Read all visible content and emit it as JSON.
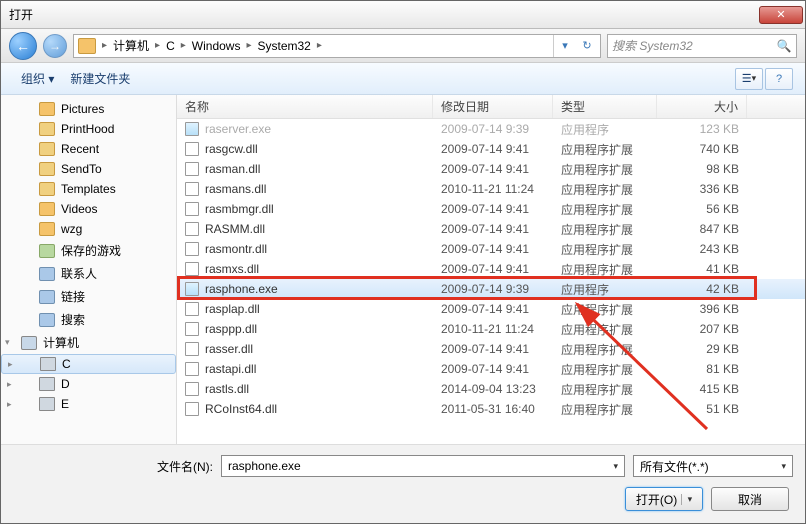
{
  "window": {
    "title": "打开"
  },
  "nav": {
    "segments": [
      "计算机",
      "C",
      "Windows",
      "System32"
    ],
    "search_placeholder": "搜索 System32"
  },
  "toolbar": {
    "organize": "组织 ▾",
    "newfolder": "新建文件夹"
  },
  "sidebar": [
    {
      "label": "Pictures",
      "icon": "folder",
      "lvl": 1
    },
    {
      "label": "PrintHood",
      "icon": "folder-alt",
      "lvl": 1
    },
    {
      "label": "Recent",
      "icon": "folder-alt",
      "lvl": 1
    },
    {
      "label": "SendTo",
      "icon": "folder-alt",
      "lvl": 1
    },
    {
      "label": "Templates",
      "icon": "folder-alt",
      "lvl": 1
    },
    {
      "label": "Videos",
      "icon": "folder",
      "lvl": 1
    },
    {
      "label": "wzg",
      "icon": "folder",
      "lvl": 1
    },
    {
      "label": "保存的游戏",
      "icon": "folder-green",
      "lvl": 1
    },
    {
      "label": "联系人",
      "icon": "folder-blue",
      "lvl": 1
    },
    {
      "label": "链接",
      "icon": "folder-blue",
      "lvl": 1
    },
    {
      "label": "搜索",
      "icon": "folder-blue",
      "lvl": 1
    },
    {
      "label": "计算机",
      "icon": "computer",
      "lvl": 0,
      "expand": "▾"
    },
    {
      "label": "C",
      "icon": "drive",
      "lvl": 1,
      "expand": "▸",
      "selected": true
    },
    {
      "label": "D",
      "icon": "drive",
      "lvl": 1,
      "expand": "▸"
    },
    {
      "label": "E",
      "icon": "drive",
      "lvl": 1,
      "expand": "▸"
    }
  ],
  "columns": {
    "name": "名称",
    "date": "修改日期",
    "type": "类型",
    "size": "大小"
  },
  "files": [
    {
      "name": "raserver.exe",
      "date": "2009-07-14 9:39",
      "type": "应用程序",
      "size": "123 KB",
      "icon": "exe",
      "dim": true
    },
    {
      "name": "rasgcw.dll",
      "date": "2009-07-14 9:41",
      "type": "应用程序扩展",
      "size": "740 KB",
      "icon": "dll"
    },
    {
      "name": "rasman.dll",
      "date": "2009-07-14 9:41",
      "type": "应用程序扩展",
      "size": "98 KB",
      "icon": "dll"
    },
    {
      "name": "rasmans.dll",
      "date": "2010-11-21 11:24",
      "type": "应用程序扩展",
      "size": "336 KB",
      "icon": "dll"
    },
    {
      "name": "rasmbmgr.dll",
      "date": "2009-07-14 9:41",
      "type": "应用程序扩展",
      "size": "56 KB",
      "icon": "dll"
    },
    {
      "name": "RASMM.dll",
      "date": "2009-07-14 9:41",
      "type": "应用程序扩展",
      "size": "847 KB",
      "icon": "dll"
    },
    {
      "name": "rasmontr.dll",
      "date": "2009-07-14 9:41",
      "type": "应用程序扩展",
      "size": "243 KB",
      "icon": "dll"
    },
    {
      "name": "rasmxs.dll",
      "date": "2009-07-14 9:41",
      "type": "应用程序扩展",
      "size": "41 KB",
      "icon": "dll"
    },
    {
      "name": "rasphone.exe",
      "date": "2009-07-14 9:39",
      "type": "应用程序",
      "size": "42 KB",
      "icon": "exe",
      "selected": true
    },
    {
      "name": "rasplap.dll",
      "date": "2009-07-14 9:41",
      "type": "应用程序扩展",
      "size": "396 KB",
      "icon": "dll"
    },
    {
      "name": "rasppp.dll",
      "date": "2010-11-21 11:24",
      "type": "应用程序扩展",
      "size": "207 KB",
      "icon": "dll"
    },
    {
      "name": "rasser.dll",
      "date": "2009-07-14 9:41",
      "type": "应用程序扩展",
      "size": "29 KB",
      "icon": "dll"
    },
    {
      "name": "rastapi.dll",
      "date": "2009-07-14 9:41",
      "type": "应用程序扩展",
      "size": "81 KB",
      "icon": "dll"
    },
    {
      "name": "rastls.dll",
      "date": "2014-09-04 13:23",
      "type": "应用程序扩展",
      "size": "415 KB",
      "icon": "dll"
    },
    {
      "name": "RCoInst64.dll",
      "date": "2011-05-31 16:40",
      "type": "应用程序扩展",
      "size": "51 KB",
      "icon": "dll"
    }
  ],
  "footer": {
    "filename_label": "文件名(N):",
    "filename_value": "rasphone.exe",
    "filter": "所有文件(*.*)",
    "open": "打开(O)",
    "cancel": "取消"
  }
}
